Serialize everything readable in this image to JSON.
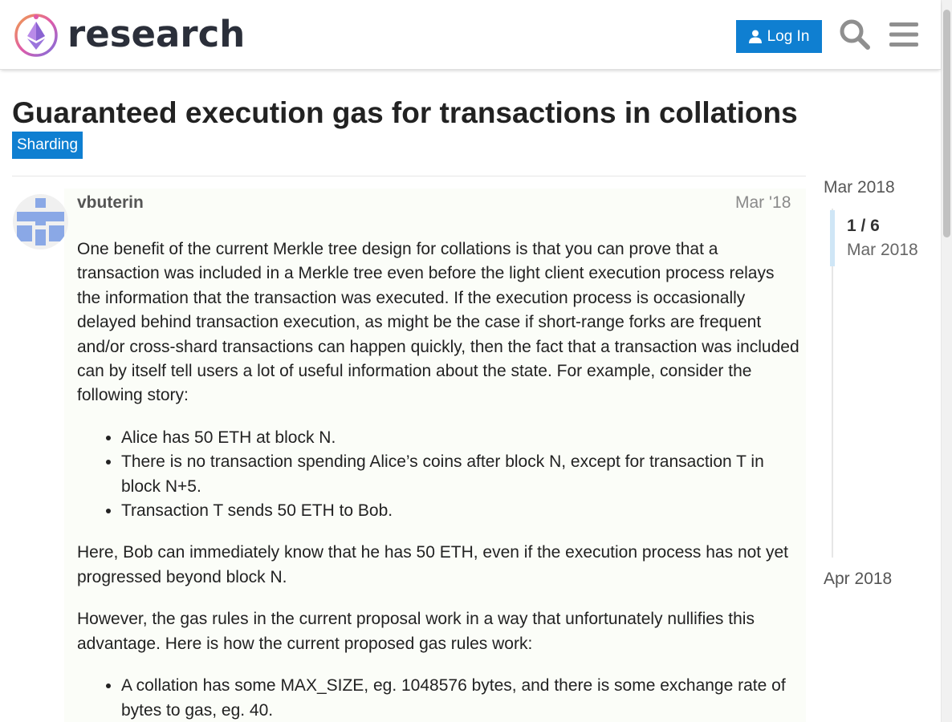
{
  "header": {
    "site_name": "research",
    "login_label": "Log In",
    "icons": [
      "user-icon",
      "search-icon",
      "hamburger-menu-icon"
    ]
  },
  "topic": {
    "title": "Guaranteed execution gas for transactions in collations",
    "category": "Sharding",
    "category_color": "#0f7fd1"
  },
  "post": {
    "username": "vbuterin",
    "date": "Mar '18",
    "paragraph1": "One benefit of the current Merkle tree design for collations is that you can prove that a transaction was included in a Merkle tree even before the light client execution process relays the information that the transaction was executed. If the execution process is occasionally delayed behind transaction execution, as might be the case if short-range forks are frequent and/or cross-shard transactions can happen quickly, then the fact that a transaction was included can by itself tell users a lot of useful information about the state. For example, consider the following story:",
    "story": [
      "Alice has 50 ETH at block N.",
      "There is no transaction spending Alice’s coins after block N, except for transaction T in block N+5.",
      "Transaction T sends 50 ETH to Bob."
    ],
    "paragraph2": "Here, Bob can immediately know that he has 50 ETH, even if the execution process has not yet progressed beyond block N.",
    "paragraph3": "However, the gas rules in the current proposal work in a way that unfortunately nullifies this advantage. Here is how the current proposed gas rules work:",
    "gas_rules": [
      "A collation has some MAX_SIZE, eg. 1048576 bytes, and there is some exchange rate of bytes to gas, eg. 40."
    ]
  },
  "timeline": {
    "start_date": "Mar 2018",
    "position": "1 / 6",
    "position_date": "Mar 2018",
    "end_date": "Apr 2018"
  },
  "colors": {
    "accent": "#0f7fd1",
    "post_background": "#fbfdf8",
    "timeline_handle": "#cfe6f6"
  }
}
